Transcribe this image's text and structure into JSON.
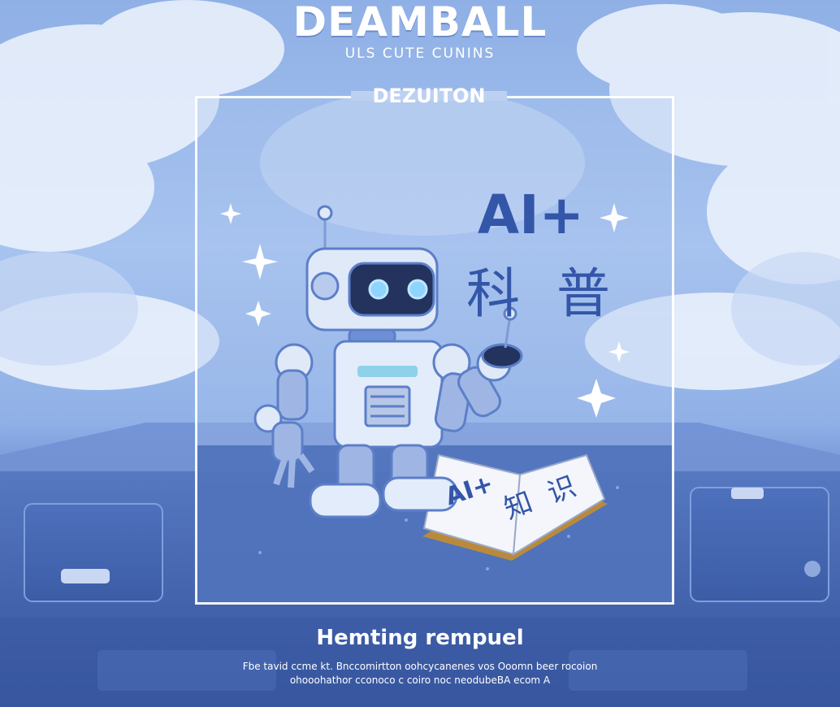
{
  "poster": {
    "title": "DEAMBALL",
    "subtitle": "ULS CUTE CUNINS",
    "frame_label": "DEZUITON",
    "headline_ai": "AI+",
    "headline_cn": "科 普",
    "book_text_left": "AI+",
    "book_text_right": "知 识",
    "bottom_title": "Hemting rempuel",
    "bottom_text": "Fbe tavid ccme kt. Bnccomirtton oohcycanenes vos Ooomn beer rocoion ohooohathor cconoco c coiro noc neodubeBA ecom A"
  },
  "colors": {
    "sky": "#a7c3ef",
    "accent_blue": "#3456a8",
    "frame": "#ffffff",
    "robot_body": "#dfe9f8",
    "robot_trim": "#6d8fd4",
    "book": "#f4f6fb"
  }
}
